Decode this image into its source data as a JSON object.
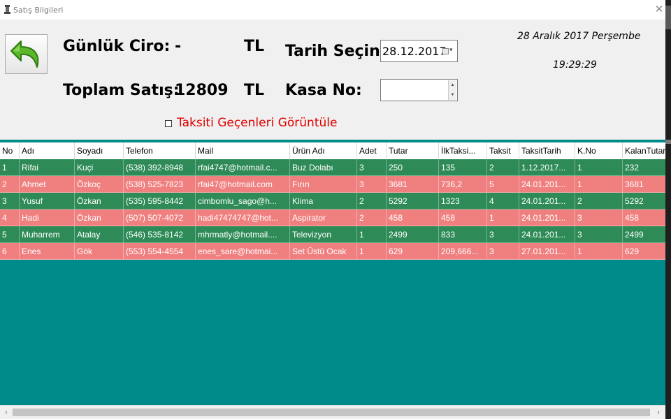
{
  "window": {
    "title": "Satış Bilgileri",
    "close_glyph": "✕"
  },
  "header": {
    "daily_revenue_label": "Günlük Ciro:",
    "daily_revenue_value": "-",
    "daily_revenue_currency": "TL",
    "total_sales_label": "Toplam Satış:",
    "total_sales_value": "12809",
    "total_sales_currency": "TL",
    "date_select_label": "Tarih Seçin:",
    "date_value": "28.12.2017",
    "register_label": "Kasa No:",
    "register_value": "",
    "current_date": "28 Aralık 2017 Perşembe",
    "current_time": "19:29:29",
    "overdue_checkbox_label": "Taksiti Geçenleri Görüntüle",
    "overdue_checked": false
  },
  "grid": {
    "columns": [
      "No",
      "Adı",
      "Soyadı",
      "Telefon",
      "Mail",
      "Ürün Adı",
      "Adet",
      "Tutar",
      "İlkTaksi...",
      "Taksit",
      "TaksitTarih",
      "K.No",
      "KalanTutar"
    ],
    "rows": [
      [
        "1",
        "Rifai",
        "Kuçi",
        "(538) 392-8948",
        "rfai4747@hotmail.c...",
        "Buz Dolabı",
        "3",
        "250",
        "135",
        "2",
        "1.12.2017...",
        "1",
        "232"
      ],
      [
        "2",
        "Ahmet",
        "Özkoç",
        "(538) 525-7823",
        "rfai47@hotmail.com",
        "Fırın",
        "3",
        "3681",
        "736,2",
        "5",
        "24.01.201...",
        "1",
        "3681"
      ],
      [
        "3",
        "Yusuf",
        "Özkan",
        "(535) 595-8442",
        "cimbomlu_sago@h...",
        "Klima",
        "2",
        "5292",
        "1323",
        "4",
        "24.01.201...",
        "2",
        "5292"
      ],
      [
        "4",
        "Hadi",
        "Özkan",
        "(507) 507-4072",
        "hadi47474747@hot...",
        "Aspirator",
        "2",
        "458",
        "458",
        "1",
        "24.01.201...",
        "3",
        "458"
      ],
      [
        "5",
        "Muharrem",
        "Atalay",
        "(546) 535-8142",
        "mhrmatly@hotmail....",
        "Televizyon",
        "1",
        "2499",
        "833",
        "3",
        "24.01.201...",
        "3",
        "2499"
      ],
      [
        "6",
        "Enes",
        "Gök",
        "(553) 554-4554",
        "enes_sare@hotmai...",
        "Set Üstü Ocak",
        "1",
        "629",
        "209,666...",
        "3",
        "27.01.201...",
        "1",
        "629"
      ]
    ],
    "row_status": [
      "ok",
      "overdue",
      "ok",
      "overdue",
      "ok",
      "overdue"
    ]
  },
  "colors": {
    "ok_row": "#2e8b57",
    "overdue_row": "#f08080",
    "grid_background": "#008b8b",
    "checkbox_label": "#e00000"
  },
  "icons": {
    "back": "back-arrow-icon",
    "calendar": "calendar-icon",
    "app": "app-icon"
  }
}
